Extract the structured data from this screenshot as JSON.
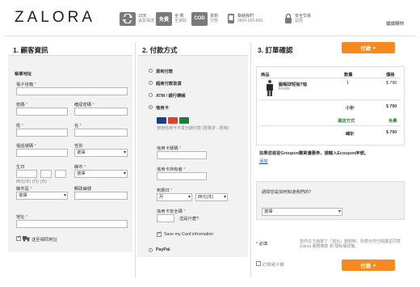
{
  "header": {
    "logo": "ZALORA",
    "features": [
      {
        "icon": "return-arrows-icon",
        "icon_text": "",
        "line1": "15天",
        "line2": "退貨保證"
      },
      {
        "icon": "free-shipping-icon",
        "icon_text": "免費",
        "line1": "全 寄",
        "line2": "全家取"
      },
      {
        "icon": "cod-icon",
        "icon_text": "COD",
        "line1": "貨到",
        "line2": "付款"
      },
      {
        "icon": "phone-icon",
        "icon_text": "",
        "line1": "聯絡我們",
        "line2": "0800-000-666"
      },
      {
        "icon": "lock-icon",
        "icon_text": "",
        "line1": "安全交易",
        "line2": "認證"
      }
    ],
    "continue_link": "繼續購物"
  },
  "col1": {
    "title": "1. 顧客資訊",
    "section": "帳單地址",
    "email_label": "電子信箱",
    "password_label": "密碼",
    "confirm_password_label": "確認密碼",
    "last_name_label": "姓",
    "first_name_label": "名",
    "phone_label": "電話號碼",
    "gender_label": "性別",
    "gender_value": "選擇",
    "birthday_label": "生日",
    "birthday_hint": "西元(年)  (月)  (日)",
    "district_label": "縣市",
    "district_value": "選擇",
    "city_label": "縣市區",
    "city_value": "選擇",
    "postcode_label": "郵政編號",
    "address_label": "地址",
    "same_address_label": "送至相同地址"
  },
  "col2": {
    "title": "2. 付款方式",
    "methods": [
      "貨到付款",
      "超商付款取貨",
      "ATM / 銀行轉帳",
      "信用卡"
    ],
    "card_hint": "使用信用卡不享分期付款 (限量折 - 限時)",
    "card_number_label": "信用卡號碼",
    "card_holder_label": "信用卡持有者",
    "expiry_label": "到期日",
    "month_value": "月",
    "year_value": "西元(年)",
    "cvv_label": "信用卡安全碼",
    "cvv_help": "這是什麼?",
    "save_card_label": "Save my Card information",
    "paypal_label": "PayPal"
  },
  "col3": {
    "title": "3. 訂單確認",
    "pay_button": "付款",
    "headers": {
      "product": "商品",
      "qty": "數量",
      "price": "價格"
    },
    "item": {
      "name": "鍛麵球短袖T恤",
      "brand": "Roots",
      "qty": "1",
      "price": "$ 790"
    },
    "subtotal_label": "小計",
    "subtotal_value": "$ 790",
    "shipping_label": "運送方式",
    "shipping_value": "免費",
    "total_label": "總計",
    "total_value": "$ 790",
    "coupon_text": "如果您是從Groupon購買優惠券，請輸入Ecoupon序號。",
    "coupon_link": "添加",
    "survey_question": "請問您是如何知道我們的?",
    "survey_value": "選擇",
    "required_label": "* 必填",
    "terms_text": "當你在下面按了「送出」按鈕時，則表示你已閱讀並同意 Zalora 服務條款 和 隱私權政策。",
    "pay_button_bottom": "付款",
    "newsletter_label": "訂閱電子報"
  }
}
